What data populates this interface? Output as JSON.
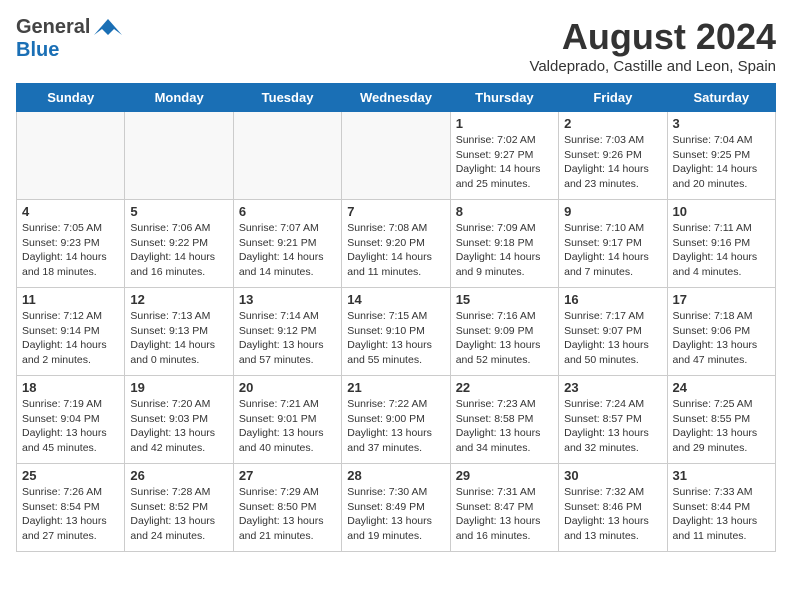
{
  "header": {
    "logo_general": "General",
    "logo_blue": "Blue",
    "month": "August 2024",
    "location": "Valdeprado, Castille and Leon, Spain"
  },
  "weekdays": [
    "Sunday",
    "Monday",
    "Tuesday",
    "Wednesday",
    "Thursday",
    "Friday",
    "Saturday"
  ],
  "weeks": [
    [
      {
        "day": "",
        "info": ""
      },
      {
        "day": "",
        "info": ""
      },
      {
        "day": "",
        "info": ""
      },
      {
        "day": "",
        "info": ""
      },
      {
        "day": "1",
        "info": "Sunrise: 7:02 AM\nSunset: 9:27 PM\nDaylight: 14 hours\nand 25 minutes."
      },
      {
        "day": "2",
        "info": "Sunrise: 7:03 AM\nSunset: 9:26 PM\nDaylight: 14 hours\nand 23 minutes."
      },
      {
        "day": "3",
        "info": "Sunrise: 7:04 AM\nSunset: 9:25 PM\nDaylight: 14 hours\nand 20 minutes."
      }
    ],
    [
      {
        "day": "4",
        "info": "Sunrise: 7:05 AM\nSunset: 9:23 PM\nDaylight: 14 hours\nand 18 minutes."
      },
      {
        "day": "5",
        "info": "Sunrise: 7:06 AM\nSunset: 9:22 PM\nDaylight: 14 hours\nand 16 minutes."
      },
      {
        "day": "6",
        "info": "Sunrise: 7:07 AM\nSunset: 9:21 PM\nDaylight: 14 hours\nand 14 minutes."
      },
      {
        "day": "7",
        "info": "Sunrise: 7:08 AM\nSunset: 9:20 PM\nDaylight: 14 hours\nand 11 minutes."
      },
      {
        "day": "8",
        "info": "Sunrise: 7:09 AM\nSunset: 9:18 PM\nDaylight: 14 hours\nand 9 minutes."
      },
      {
        "day": "9",
        "info": "Sunrise: 7:10 AM\nSunset: 9:17 PM\nDaylight: 14 hours\nand 7 minutes."
      },
      {
        "day": "10",
        "info": "Sunrise: 7:11 AM\nSunset: 9:16 PM\nDaylight: 14 hours\nand 4 minutes."
      }
    ],
    [
      {
        "day": "11",
        "info": "Sunrise: 7:12 AM\nSunset: 9:14 PM\nDaylight: 14 hours\nand 2 minutes."
      },
      {
        "day": "12",
        "info": "Sunrise: 7:13 AM\nSunset: 9:13 PM\nDaylight: 14 hours\nand 0 minutes."
      },
      {
        "day": "13",
        "info": "Sunrise: 7:14 AM\nSunset: 9:12 PM\nDaylight: 13 hours\nand 57 minutes."
      },
      {
        "day": "14",
        "info": "Sunrise: 7:15 AM\nSunset: 9:10 PM\nDaylight: 13 hours\nand 55 minutes."
      },
      {
        "day": "15",
        "info": "Sunrise: 7:16 AM\nSunset: 9:09 PM\nDaylight: 13 hours\nand 52 minutes."
      },
      {
        "day": "16",
        "info": "Sunrise: 7:17 AM\nSunset: 9:07 PM\nDaylight: 13 hours\nand 50 minutes."
      },
      {
        "day": "17",
        "info": "Sunrise: 7:18 AM\nSunset: 9:06 PM\nDaylight: 13 hours\nand 47 minutes."
      }
    ],
    [
      {
        "day": "18",
        "info": "Sunrise: 7:19 AM\nSunset: 9:04 PM\nDaylight: 13 hours\nand 45 minutes."
      },
      {
        "day": "19",
        "info": "Sunrise: 7:20 AM\nSunset: 9:03 PM\nDaylight: 13 hours\nand 42 minutes."
      },
      {
        "day": "20",
        "info": "Sunrise: 7:21 AM\nSunset: 9:01 PM\nDaylight: 13 hours\nand 40 minutes."
      },
      {
        "day": "21",
        "info": "Sunrise: 7:22 AM\nSunset: 9:00 PM\nDaylight: 13 hours\nand 37 minutes."
      },
      {
        "day": "22",
        "info": "Sunrise: 7:23 AM\nSunset: 8:58 PM\nDaylight: 13 hours\nand 34 minutes."
      },
      {
        "day": "23",
        "info": "Sunrise: 7:24 AM\nSunset: 8:57 PM\nDaylight: 13 hours\nand 32 minutes."
      },
      {
        "day": "24",
        "info": "Sunrise: 7:25 AM\nSunset: 8:55 PM\nDaylight: 13 hours\nand 29 minutes."
      }
    ],
    [
      {
        "day": "25",
        "info": "Sunrise: 7:26 AM\nSunset: 8:54 PM\nDaylight: 13 hours\nand 27 minutes."
      },
      {
        "day": "26",
        "info": "Sunrise: 7:28 AM\nSunset: 8:52 PM\nDaylight: 13 hours\nand 24 minutes."
      },
      {
        "day": "27",
        "info": "Sunrise: 7:29 AM\nSunset: 8:50 PM\nDaylight: 13 hours\nand 21 minutes."
      },
      {
        "day": "28",
        "info": "Sunrise: 7:30 AM\nSunset: 8:49 PM\nDaylight: 13 hours\nand 19 minutes."
      },
      {
        "day": "29",
        "info": "Sunrise: 7:31 AM\nSunset: 8:47 PM\nDaylight: 13 hours\nand 16 minutes."
      },
      {
        "day": "30",
        "info": "Sunrise: 7:32 AM\nSunset: 8:46 PM\nDaylight: 13 hours\nand 13 minutes."
      },
      {
        "day": "31",
        "info": "Sunrise: 7:33 AM\nSunset: 8:44 PM\nDaylight: 13 hours\nand 11 minutes."
      }
    ]
  ]
}
